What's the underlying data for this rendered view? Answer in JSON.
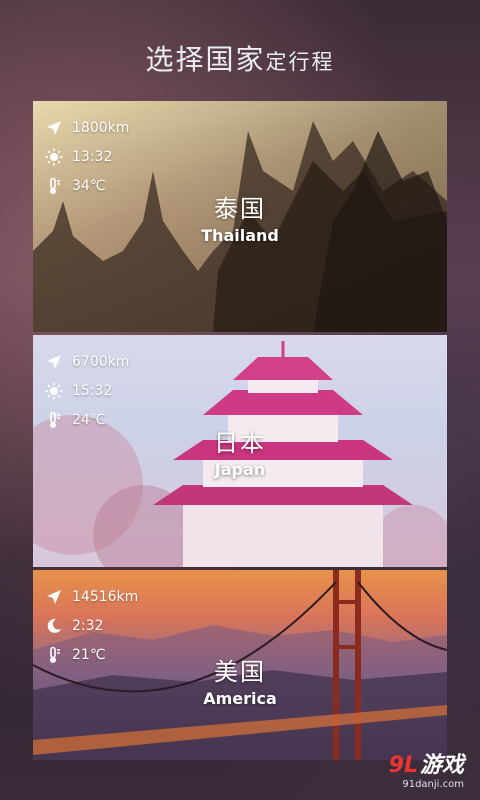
{
  "header": {
    "title_main": "选择国家",
    "title_sub": "定行程"
  },
  "destinations": [
    {
      "cn": "泰国",
      "en": "Thailand",
      "distance": "1800km",
      "time": "13:32",
      "temperature": "34℃"
    },
    {
      "cn": "日本",
      "en": "Japan",
      "distance": "6700km",
      "time": "15:32",
      "temperature": "24℃"
    },
    {
      "cn": "美国",
      "en": "America",
      "distance": "14516km",
      "time": "2:32",
      "temperature": "21℃"
    }
  ],
  "icons": {
    "distance": "navigation-arrow-icon",
    "day": "sun-icon",
    "night": "moon-icon",
    "temperature": "thermometer-icon"
  },
  "watermark": {
    "logo_num": "9L",
    "logo_text": "游戏",
    "site": "91danji.com"
  }
}
